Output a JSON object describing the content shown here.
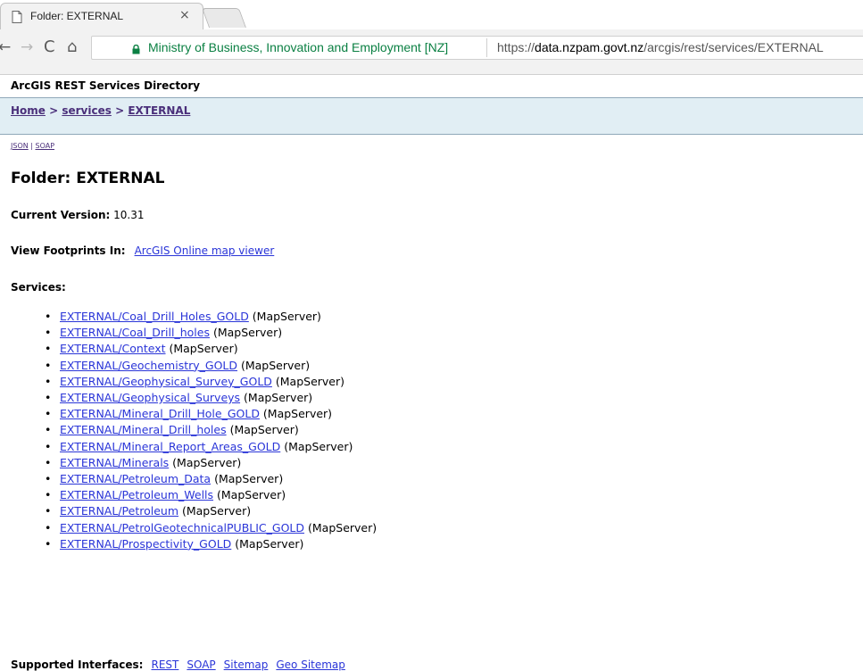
{
  "browser": {
    "tab_title": "Folder: EXTERNAL",
    "tab_close": "×",
    "back_glyph": "←",
    "forward_glyph": "→",
    "reload_glyph": "C",
    "home_glyph": "⌂",
    "security_org": "Ministry of Business, Innovation and Employment [NZ]",
    "url_scheme": "https://",
    "url_host": "data.nzpam.govt.nz",
    "url_path": "/arcgis/rest/services/EXTERNAL",
    "accent_secure": "#0b8043"
  },
  "page": {
    "directory_title": "ArcGIS REST Services Directory",
    "breadcrumb": {
      "home": "Home",
      "sep1": " > ",
      "services": "services",
      "sep2": " > ",
      "external": "EXTERNAL"
    },
    "formats": {
      "json": "JSON",
      "sep": " | ",
      "soap": "SOAP"
    },
    "folder_title": "Folder: EXTERNAL",
    "current_version_label": "Current Version:",
    "current_version_value": " 10.31",
    "footprints_label": "View Footprints In:",
    "footprints_link": "ArcGIS Online map viewer",
    "services_label": "Services:",
    "services": [
      {
        "name": "EXTERNAL/Coal_Drill_Holes_GOLD",
        "type": " (MapServer)"
      },
      {
        "name": "EXTERNAL/Coal_Drill_holes",
        "type": " (MapServer)"
      },
      {
        "name": "EXTERNAL/Context",
        "type": " (MapServer)"
      },
      {
        "name": "EXTERNAL/Geochemistry_GOLD",
        "type": " (MapServer)"
      },
      {
        "name": "EXTERNAL/Geophysical_Survey_GOLD",
        "type": " (MapServer)"
      },
      {
        "name": "EXTERNAL/Geophysical_Surveys",
        "type": " (MapServer)"
      },
      {
        "name": "EXTERNAL/Mineral_Drill_Hole_GOLD",
        "type": " (MapServer)"
      },
      {
        "name": "EXTERNAL/Mineral_Drill_holes",
        "type": " (MapServer)"
      },
      {
        "name": "EXTERNAL/Mineral_Report_Areas_GOLD",
        "type": " (MapServer)"
      },
      {
        "name": "EXTERNAL/Minerals",
        "type": " (MapServer)"
      },
      {
        "name": "EXTERNAL/Petroleum_Data",
        "type": " (MapServer)"
      },
      {
        "name": "EXTERNAL/Petroleum_Wells",
        "type": " (MapServer)"
      },
      {
        "name": "EXTERNAL/Petroleum",
        "type": " (MapServer)"
      },
      {
        "name": "EXTERNAL/PetrolGeotechnicalPUBLIC_GOLD",
        "type": " (MapServer)"
      },
      {
        "name": "EXTERNAL/Prospectivity_GOLD",
        "type": " (MapServer)"
      }
    ],
    "interfaces_label": "Supported Interfaces:",
    "interfaces": [
      "REST",
      "SOAP",
      "Sitemap",
      "Geo Sitemap"
    ]
  }
}
